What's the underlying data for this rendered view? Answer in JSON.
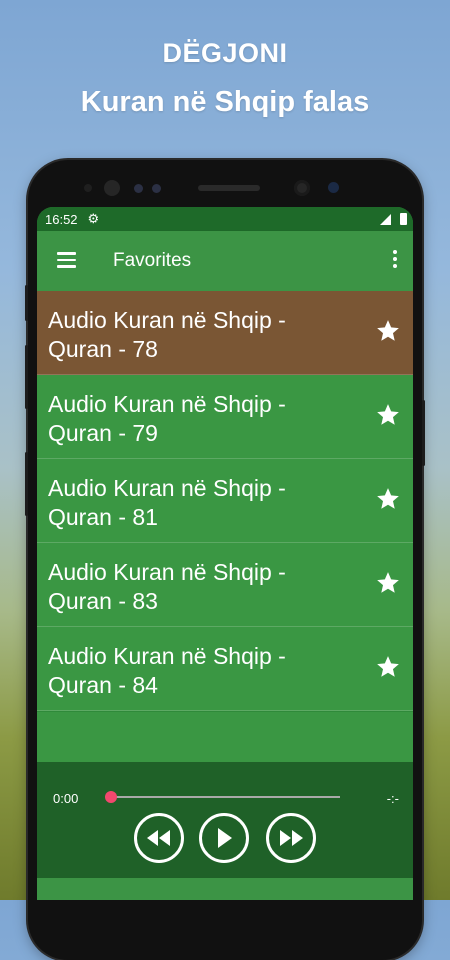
{
  "promo": {
    "line1": "DËGJONI",
    "line2": "Kuran në Shqip falas"
  },
  "status_bar": {
    "time": "16:52",
    "settings_icon": "gear-icon"
  },
  "app_bar": {
    "title": "Favorites",
    "menu_icon": "hamburger-menu-icon",
    "more_icon": "more-vert-icon"
  },
  "favorites": [
    {
      "line1": "Audio Kuran në Shqip -",
      "line2": "Quran - 78",
      "selected": true
    },
    {
      "line1": "Audio Kuran në Shqip -",
      "line2": "Quran - 79",
      "selected": false
    },
    {
      "line1": "Audio Kuran në Shqip -",
      "line2": "Quran - 81",
      "selected": false
    },
    {
      "line1": "Audio Kuran në Shqip -",
      "line2": "Quran - 83",
      "selected": false
    },
    {
      "line1": "Audio Kuran në Shqip -",
      "line2": "Quran - 84",
      "selected": false
    }
  ],
  "player": {
    "current_time": "0:00",
    "duration": "-:-",
    "progress": 0,
    "controls": [
      "rewind-icon",
      "play-icon",
      "fast-forward-icon"
    ]
  },
  "colors": {
    "primary": "#3c9445",
    "primary_dark": "#1e6a29",
    "selected_row": "#7a5634",
    "player_bg": "#1f6128",
    "seek_thumb": "#f2486e"
  }
}
